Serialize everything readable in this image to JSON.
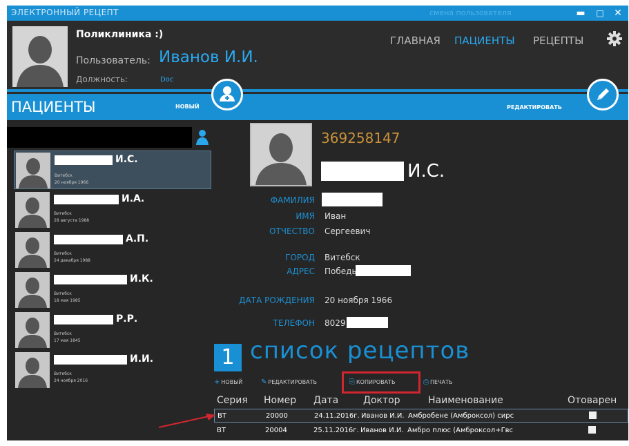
{
  "window": {
    "title": "ЭЛЕКТРОННЫЙ РЕЦЕПТ",
    "change_user": "смена пользователя",
    "minimize_glyph": "▬",
    "maximize_glyph": "□",
    "close_glyph": "✕"
  },
  "header": {
    "clinic": "Поликлиника :)",
    "user_label": "Пользователь:",
    "user_name": "Иванов И.И.",
    "position_label": "Должность:",
    "position_value": "Doc",
    "nav": [
      {
        "label": "ГЛАВНАЯ",
        "active": false
      },
      {
        "label": "ПАЦИЕНТЫ",
        "active": true
      },
      {
        "label": "РЕЦЕПТЫ",
        "active": false
      }
    ],
    "settings_icon": "gear-icon"
  },
  "panel": {
    "title": "ПАЦИЕНТЫ",
    "new_label": "НОВЫЙ",
    "edit_label": "РЕДАКТИРОВАТЬ"
  },
  "patients": [
    {
      "initials": "И.С.",
      "city": "Витебск",
      "dob": "20 ноября 1966",
      "selected": true
    },
    {
      "initials": "И.А.",
      "city": "Витебск",
      "dob": "28 августа 1988",
      "selected": false
    },
    {
      "initials": "А.П.",
      "city": "Витебск",
      "dob": "24 декабря 1988",
      "selected": false
    },
    {
      "initials": "И.К.",
      "city": "Витебск",
      "dob": "18 мая 1985",
      "selected": false
    },
    {
      "initials": "Р.Р.",
      "city": "Витебск",
      "dob": "17 мая 1845",
      "selected": false
    },
    {
      "initials": "И.И.",
      "city": "Витебск",
      "dob": "24 ноября 2016",
      "selected": false
    }
  ],
  "detail": {
    "id": "369258147",
    "initials": "И.С.",
    "fields": [
      {
        "label": "ФАМИЛИЯ",
        "value": ""
      },
      {
        "label": "ИМЯ",
        "value": "Иван"
      },
      {
        "label": "ОТЧЕСТВО",
        "value": "Сергеевич"
      },
      {
        "label": "ГОРОД",
        "value": "Витебск"
      },
      {
        "label": "АДРЕС",
        "value": "Победы"
      },
      {
        "label": "ДАТА РОЖДЕНИЯ",
        "value": "20 ноября 1966"
      },
      {
        "label": "ТЕЛЕФОН",
        "value": "8029"
      }
    ]
  },
  "recipes": {
    "count": "1",
    "title": "список рецептов",
    "toolbar": [
      {
        "icon": "plus-icon",
        "glyph": "+",
        "label": "НОВЫЙ"
      },
      {
        "icon": "pencil-icon",
        "glyph": "✎",
        "label": "РЕДАКТИРОВАТЬ"
      },
      {
        "icon": "copy-icon",
        "glyph": "⎘",
        "label": "КОПИРОВАТЬ"
      },
      {
        "icon": "print-icon",
        "glyph": "⎙",
        "label": "ПЕЧАТЬ"
      }
    ],
    "columns": [
      "Серия",
      "Номер",
      "Дата",
      "Доктор",
      "Наименование",
      "Отоварен"
    ],
    "rows": [
      {
        "series": "BT",
        "number": "20000",
        "date": "24.11.2016г.",
        "doctor": "Иванов И.И.",
        "name": "Амбробене (Амброксол) сирс",
        "dispensed": false,
        "selected": true
      },
      {
        "series": "BT",
        "number": "20004",
        "date": "25.11.2016г.",
        "doctor": "Иванов И.И.",
        "name": "Амбро плюс (Амброксол+Гвс",
        "dispensed": false,
        "selected": false
      }
    ]
  },
  "colors": {
    "accent": "#1a90d4",
    "background": "#262626",
    "highlight": "#d1262f",
    "id_color": "#c9923a"
  }
}
